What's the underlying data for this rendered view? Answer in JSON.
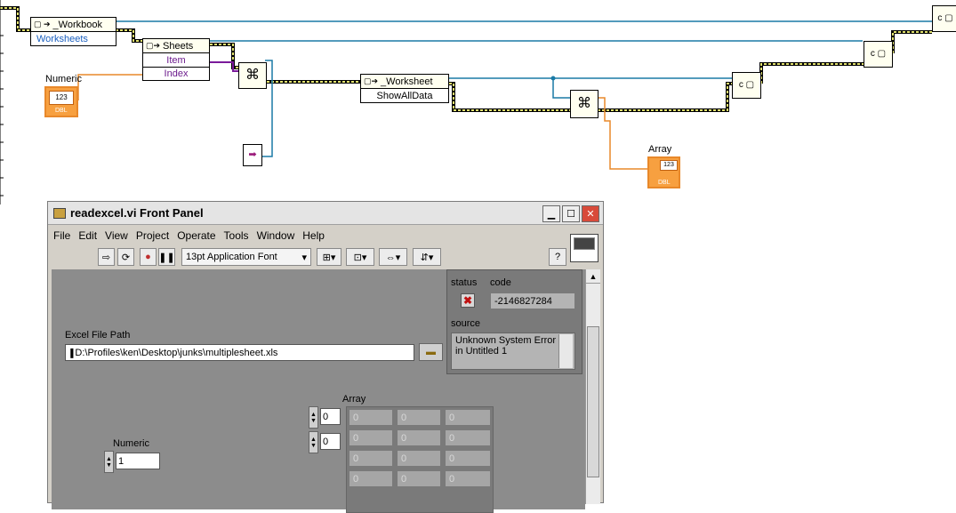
{
  "diagram": {
    "workbook_node": {
      "title": "_Workbook",
      "prop": "Worksheets"
    },
    "sheets_node": {
      "title": "Sheets",
      "props": [
        "Item",
        "Index"
      ]
    },
    "worksheet_node": {
      "title": "_Worksheet",
      "prop": "ShowAllData"
    },
    "numeric_terminal": {
      "label": "Numeric",
      "value": "123",
      "type": "DBL"
    },
    "array_terminal": {
      "label": "Array",
      "value": "123",
      "type": "DBL"
    }
  },
  "window": {
    "title": "readexcel.vi Front Panel",
    "menu": [
      "File",
      "Edit",
      "View",
      "Project",
      "Operate",
      "Tools",
      "Window",
      "Help"
    ],
    "font_selector": "13pt Application Font"
  },
  "panel": {
    "error_cluster": {
      "status_label": "status",
      "code_label": "code",
      "code_value": "-2146827284",
      "source_label": "source",
      "source_line1": "Unknown System Error",
      "source_line2": "in Untitled 1"
    },
    "excel_path": {
      "label": "Excel File Path",
      "value": "D:\\Profiles\\ken\\Desktop\\junks\\multiplesheet.xls"
    },
    "array": {
      "label": "Array",
      "index0": "0",
      "index1": "0",
      "cells": [
        [
          "0",
          "0",
          "0"
        ],
        [
          "0",
          "0",
          "0"
        ],
        [
          "0",
          "0",
          "0"
        ],
        [
          "0",
          "0",
          "0"
        ]
      ]
    },
    "numeric": {
      "label": "Numeric",
      "value": "1"
    }
  },
  "colors": {
    "wire_refnum": "#4a4a2a",
    "wire_blue": "#1a7aa6",
    "wire_orange": "#e8882a",
    "wire_purple": "#7a1a9a",
    "wire_yellow": "#c8c840"
  }
}
